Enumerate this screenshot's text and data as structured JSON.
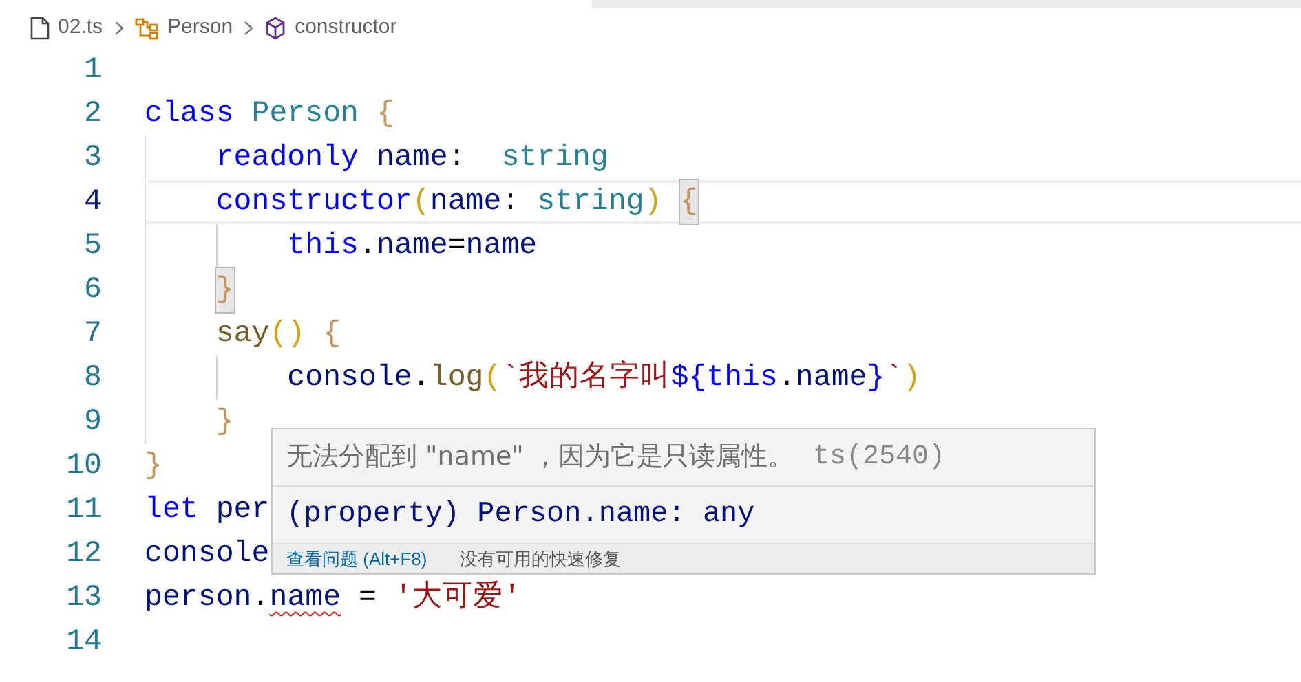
{
  "breadcrumbs": [
    {
      "label": "02.ts",
      "kind": "file"
    },
    {
      "label": "Person",
      "kind": "class"
    },
    {
      "label": "constructor",
      "kind": "method"
    }
  ],
  "lines": [
    {
      "number": "1",
      "current": false
    },
    {
      "number": "2",
      "current": false,
      "tokens": [
        {
          "text": "class ",
          "kind": "keyword"
        },
        {
          "text": "Person ",
          "kind": "type"
        },
        {
          "text": "{",
          "kind": "brace"
        }
      ]
    },
    {
      "number": "3",
      "current": false,
      "tokens": [
        {
          "text": "    readonly ",
          "kind": "keyword"
        },
        {
          "text": "name",
          "kind": "prop"
        },
        {
          "text": ":  ",
          "kind": "plain"
        },
        {
          "text": "string",
          "kind": "type"
        }
      ]
    },
    {
      "number": "4",
      "current": true,
      "tokens": [
        {
          "text": "    constructor",
          "kind": "keyword"
        },
        {
          "text": "(",
          "kind": "bracket"
        },
        {
          "text": "name",
          "kind": "prop"
        },
        {
          "text": ": ",
          "kind": "plain"
        },
        {
          "text": "string",
          "kind": "type"
        },
        {
          "text": ") ",
          "kind": "bracket"
        },
        {
          "text": "{",
          "kind": "brace_match"
        }
      ]
    },
    {
      "number": "5",
      "current": false,
      "tokens": [
        {
          "text": "        this",
          "kind": "keyword"
        },
        {
          "text": ".",
          "kind": "plain"
        },
        {
          "text": "name",
          "kind": "prop"
        },
        {
          "text": "=",
          "kind": "plain"
        },
        {
          "text": "name",
          "kind": "prop"
        }
      ]
    },
    {
      "number": "6",
      "current": false,
      "tokens": [
        {
          "text": "    }",
          "kind": "brace_match"
        }
      ]
    },
    {
      "number": "7",
      "current": false,
      "tokens": [
        {
          "text": "    say",
          "kind": "fn"
        },
        {
          "text": "() ",
          "kind": "bracket"
        },
        {
          "text": "{",
          "kind": "brace"
        }
      ]
    },
    {
      "number": "8",
      "current": false,
      "tokens": [
        {
          "text": "        console",
          "kind": "prop"
        },
        {
          "text": ".",
          "kind": "plain"
        },
        {
          "text": "log",
          "kind": "fn"
        },
        {
          "text": "(",
          "kind": "bracket"
        },
        {
          "text": "`我的名字叫",
          "kind": "string"
        },
        {
          "text": "${",
          "kind": "keyword"
        },
        {
          "text": "this",
          "kind": "keyword"
        },
        {
          "text": ".",
          "kind": "plain"
        },
        {
          "text": "name",
          "kind": "prop"
        },
        {
          "text": "}",
          "kind": "keyword"
        },
        {
          "text": "`",
          "kind": "string"
        },
        {
          "text": ")",
          "kind": "bracket"
        }
      ]
    },
    {
      "number": "9",
      "current": false,
      "tokens": [
        {
          "text": "    }",
          "kind": "brace"
        }
      ]
    },
    {
      "number": "10",
      "current": false,
      "tokens": [
        {
          "text": "}",
          "kind": "brace"
        }
      ]
    },
    {
      "number": "11",
      "current": false,
      "tokens": [
        {
          "text": "let ",
          "kind": "keyword"
        },
        {
          "text": "per",
          "kind": "prop"
        }
      ]
    },
    {
      "number": "12",
      "current": false,
      "tokens": [
        {
          "text": "console",
          "kind": "prop"
        }
      ]
    },
    {
      "number": "13",
      "current": false,
      "tokens": [
        {
          "text": "person",
          "kind": "prop"
        },
        {
          "text": ".",
          "kind": "plain"
        },
        {
          "text": "name",
          "kind": "prop_error"
        },
        {
          "text": " = ",
          "kind": "plain"
        },
        {
          "text": "'大可爱'",
          "kind": "string"
        }
      ]
    },
    {
      "number": "14",
      "current": false
    }
  ],
  "hover": {
    "message": "无法分配到 \"name\" ，因为它是只读属性。",
    "code": "ts(2540)",
    "signature": "(property) Person.name: any",
    "link": "查看问题 (Alt+F8)",
    "note": "没有可用的快速修复"
  }
}
